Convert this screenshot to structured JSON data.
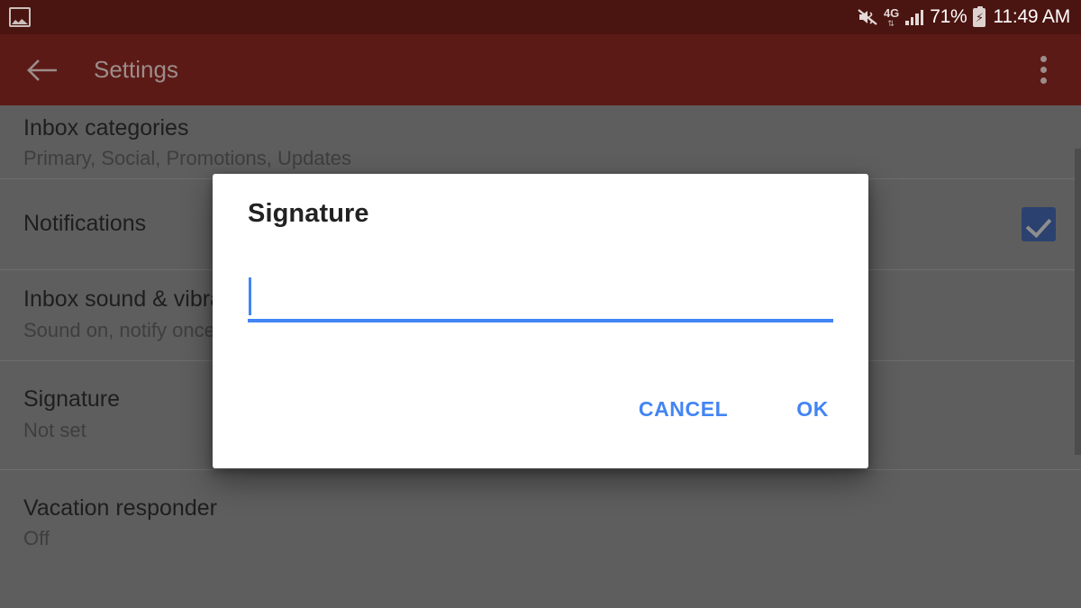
{
  "status_bar": {
    "left_icons": [
      {
        "name": "screenshot-image-icon",
        "glyph": "image"
      }
    ],
    "right_icons": [
      {
        "name": "sound-mute-vibrate-icon",
        "glyph": "speaker-muted"
      },
      {
        "name": "network-type-icon",
        "glyph": "4G"
      }
    ],
    "network_label": "4G",
    "network_arrows": "⇅",
    "signal_bars": 4,
    "battery_percent": "71%",
    "battery_charging": true,
    "time": "11:49 AM",
    "background_color": "#4a1410"
  },
  "app_bar": {
    "back_label": "Back",
    "title": "Settings",
    "overflow_label": "More options",
    "background_color": "#5c1a16",
    "title_color": "#9c8d8b"
  },
  "settings_list": {
    "rows": [
      {
        "title": "Inbox categories",
        "subtitle": "Primary, Social, Promotions, Updates",
        "control": "none"
      },
      {
        "title": "Notifications",
        "subtitle": "",
        "control": "checkbox",
        "checked": true
      },
      {
        "title": "Inbox sound & vibrate",
        "subtitle": "Sound on, notify once",
        "control": "none"
      },
      {
        "title": "Signature",
        "subtitle": "Not set",
        "control": "none"
      },
      {
        "title": "Vacation responder",
        "subtitle": "Off",
        "control": "none"
      }
    ],
    "background_color": "#5e5e5e"
  },
  "dialog": {
    "title": "Signature",
    "input_value": "",
    "input_placeholder": "",
    "accent_color": "#4285f4",
    "cancel_label": "CANCEL",
    "ok_label": "OK"
  }
}
